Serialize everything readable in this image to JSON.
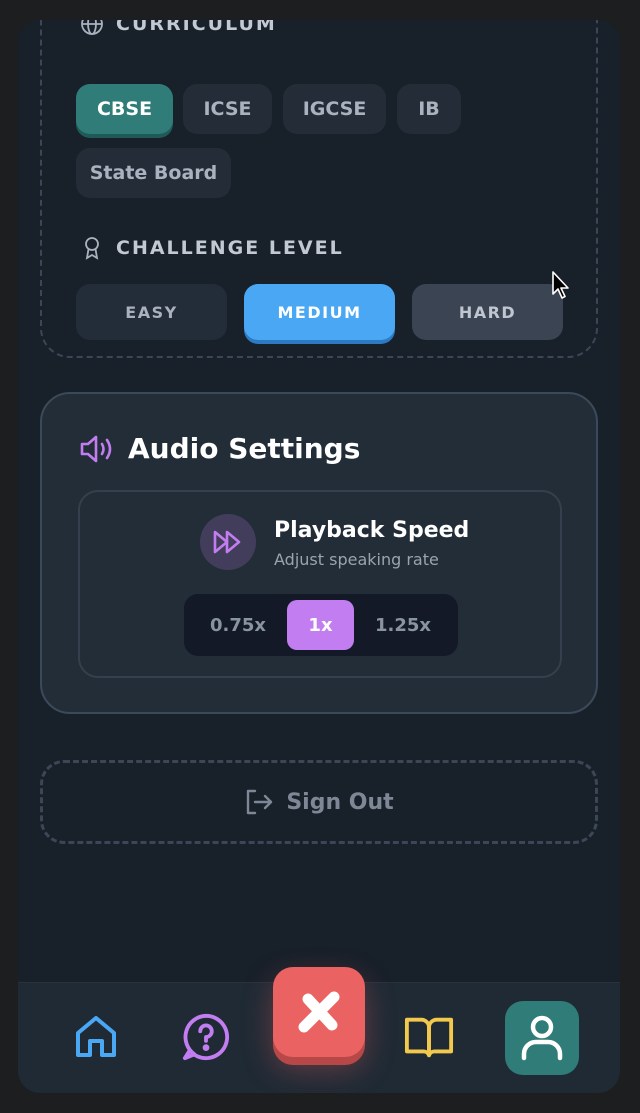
{
  "curriculum": {
    "heading": "CURRICULUM",
    "options": [
      "CBSE",
      "ICSE",
      "IGCSE",
      "IB",
      "State Board"
    ],
    "selected": "CBSE"
  },
  "challenge": {
    "heading": "CHALLENGE LEVEL",
    "options": [
      "EASY",
      "MEDIUM",
      "HARD"
    ],
    "selected": "MEDIUM"
  },
  "audio": {
    "title": "Audio Settings",
    "playback": {
      "title": "Playback Speed",
      "subtitle": "Adjust speaking rate",
      "options": [
        "0.75x",
        "1x",
        "1.25x"
      ],
      "selected": "1x"
    }
  },
  "signout": {
    "label": "Sign Out"
  },
  "nav": {
    "items": [
      "home-icon",
      "help-icon",
      "close-icon",
      "book-icon",
      "profile-icon"
    ],
    "active": "profile-icon"
  },
  "colors": {
    "teal": "#2f7c79",
    "blue": "#4aa7f4",
    "purple": "#c27ef0",
    "red": "#ea6262",
    "yellow": "#f2c94c"
  }
}
